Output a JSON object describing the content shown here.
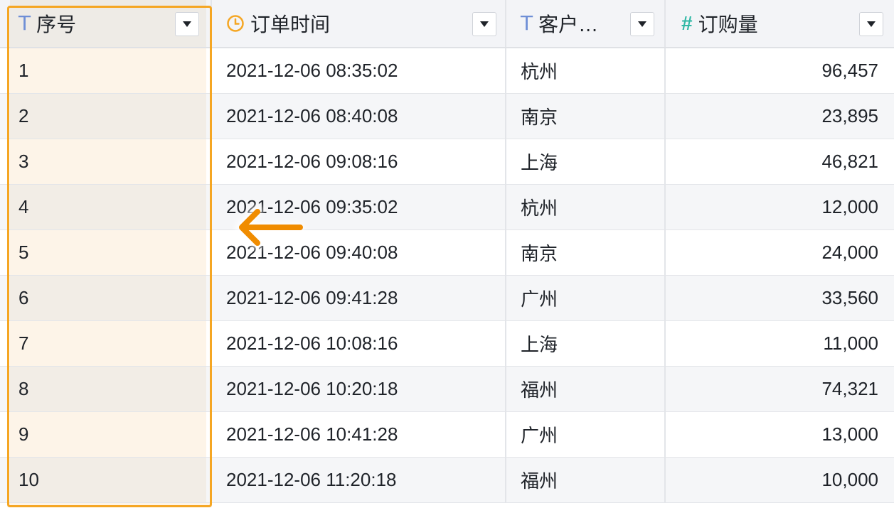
{
  "table": {
    "columns": [
      {
        "label": "序号",
        "type_icon": "text-type-icon",
        "glyph": "T"
      },
      {
        "label": "订单时间",
        "type_icon": "clock-icon"
      },
      {
        "label": "客户…",
        "type_icon": "text-type-icon",
        "glyph": "T"
      },
      {
        "label": "订购量",
        "type_icon": "number-type-icon",
        "glyph": "#"
      }
    ],
    "rows": [
      {
        "id": "1",
        "time": "2021-12-06 08:35:02",
        "city": "杭州",
        "qty": "96,457"
      },
      {
        "id": "2",
        "time": "2021-12-06 08:40:08",
        "city": "南京",
        "qty": "23,895"
      },
      {
        "id": "3",
        "time": "2021-12-06 09:08:16",
        "city": "上海",
        "qty": "46,821"
      },
      {
        "id": "4",
        "time": "2021-12-06 09:35:02",
        "city": "杭州",
        "qty": "12,000"
      },
      {
        "id": "5",
        "time": "2021-12-06 09:40:08",
        "city": "南京",
        "qty": "24,000"
      },
      {
        "id": "6",
        "time": "2021-12-06 09:41:28",
        "city": "广州",
        "qty": "33,560"
      },
      {
        "id": "7",
        "time": "2021-12-06 10:08:16",
        "city": "上海",
        "qty": "11,000"
      },
      {
        "id": "8",
        "time": "2021-12-06 10:20:18",
        "city": "福州",
        "qty": "74,321"
      },
      {
        "id": "9",
        "time": "2021-12-06 10:41:28",
        "city": "广州",
        "qty": "13,000"
      },
      {
        "id": "10",
        "time": "2021-12-06 11:20:18",
        "city": "福州",
        "qty": "10,000"
      }
    ]
  },
  "colors": {
    "selection_border": "#f5a623",
    "selection_fill": "#fdf4e8",
    "arrow": "#f08c00",
    "text_type_icon": "#6f8fd6",
    "number_type_icon": "#2fb8a5",
    "clock_icon": "#f5a623"
  }
}
